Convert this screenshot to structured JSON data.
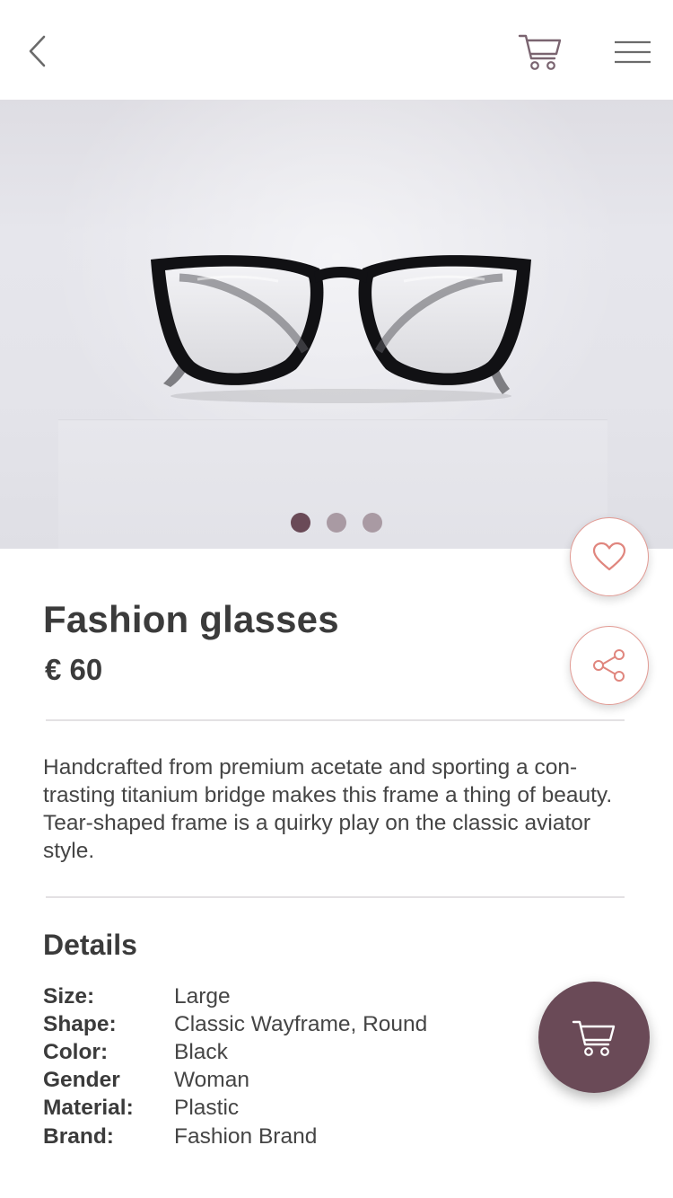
{
  "header": {
    "back_icon": "chevron-left-icon",
    "cart_icon": "cart-icon",
    "menu_icon": "hamburger-menu-icon"
  },
  "gallery": {
    "slides_total": 3,
    "active_slide": 1
  },
  "product": {
    "title": "Fashion glasses",
    "price": "€ 60",
    "description": "Handcrafted from premium acetate and sporting a con-trasting titanium bridge makes this frame a thing of beauty. Tear-shaped frame is a quirky play on the classic aviator style."
  },
  "actions": {
    "favorite_icon": "heart-icon",
    "share_icon": "share-icon",
    "add_to_cart_icon": "cart-icon"
  },
  "details": {
    "title": "Details",
    "rows": [
      {
        "label": "Size:",
        "value": "Large"
      },
      {
        "label": "Shape:",
        "value": "Classic Wayframe, Round"
      },
      {
        "label": "Color:",
        "value": "Black"
      },
      {
        "label": "Gender",
        "value": "Woman"
      },
      {
        "label": "Material:",
        "value": "Plastic"
      },
      {
        "label": "Brand:",
        "value": "Fashion Brand"
      }
    ]
  },
  "colors": {
    "accent": "#6a4a57",
    "dot_inactive": "#a99aa3",
    "outline": "#e29a93",
    "text": "#3b3b3b"
  }
}
